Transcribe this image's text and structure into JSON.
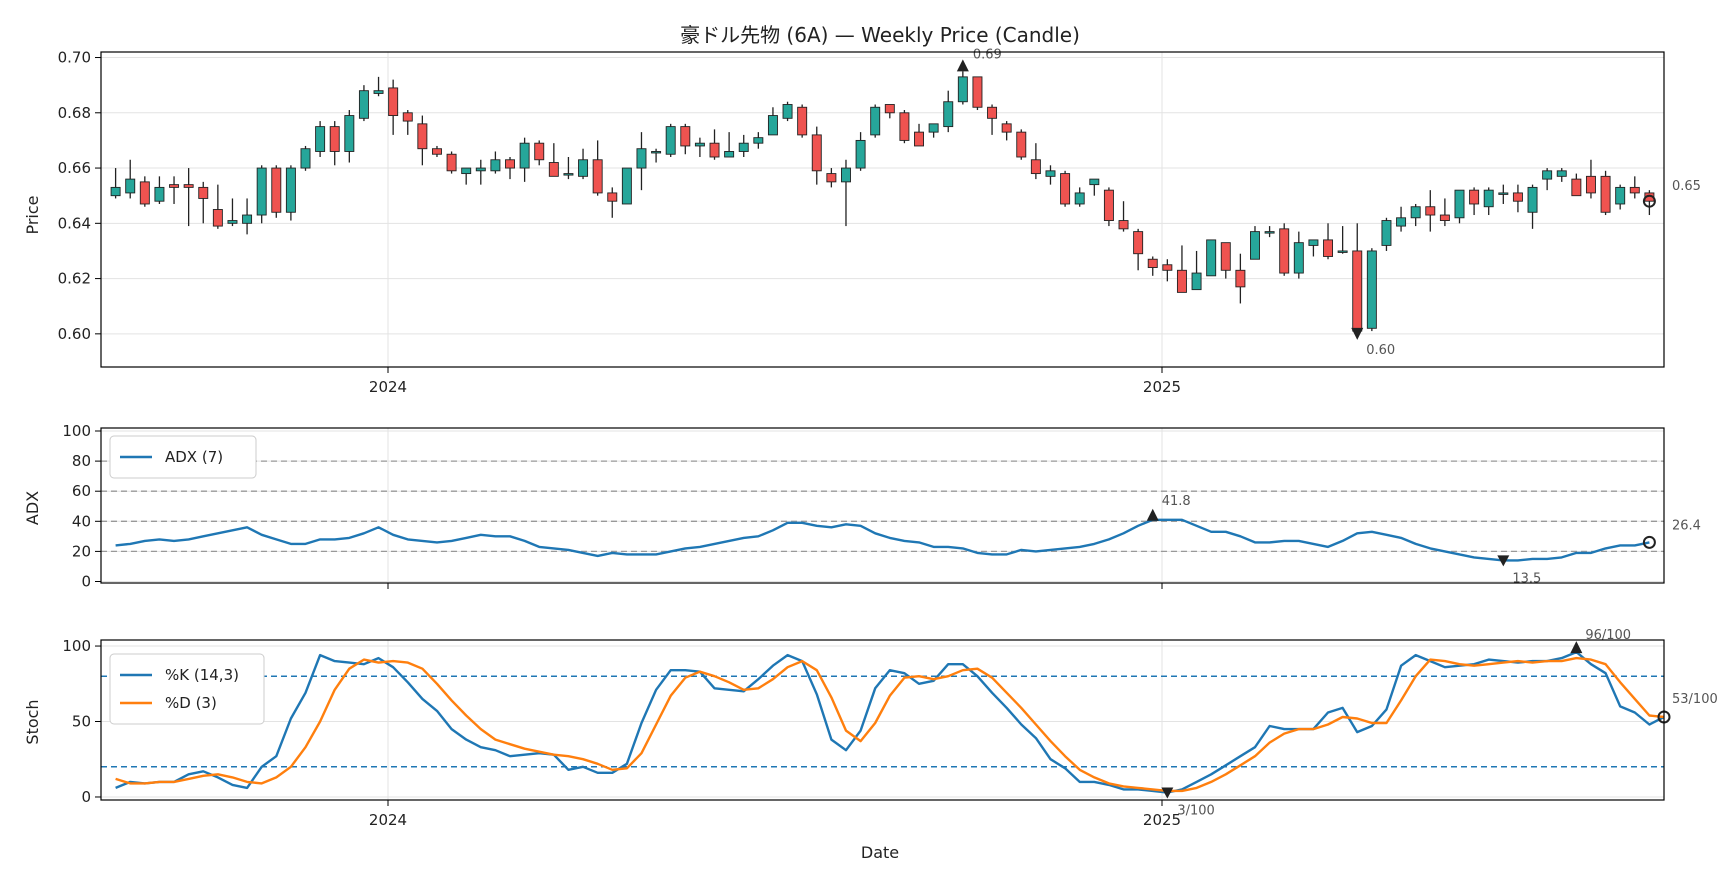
{
  "chart_data": [
    {
      "type": "candlestick",
      "title": "豪ドル先物 (6A) — Weekly Price (Candle)",
      "ylabel": "Price",
      "ylim": [
        0.588,
        0.702
      ],
      "yticks": [
        "0.60",
        "0.62",
        "0.64",
        "0.66",
        "0.68",
        "0.70"
      ],
      "xticks": [
        "2024",
        "2025"
      ],
      "up_color": "#26a69a",
      "down_color": "#ef5350",
      "annotations": {
        "high": "0.69",
        "low": "0.60",
        "last": "0.65"
      },
      "ohlc": [
        [
          0.65,
          0.66,
          0.649,
          0.653
        ],
        [
          0.651,
          0.663,
          0.649,
          0.656
        ],
        [
          0.655,
          0.657,
          0.646,
          0.647
        ],
        [
          0.648,
          0.657,
          0.647,
          0.653
        ],
        [
          0.654,
          0.657,
          0.647,
          0.653
        ],
        [
          0.654,
          0.66,
          0.639,
          0.653
        ],
        [
          0.653,
          0.655,
          0.64,
          0.649
        ],
        [
          0.645,
          0.654,
          0.638,
          0.639
        ],
        [
          0.64,
          0.649,
          0.639,
          0.641
        ],
        [
          0.64,
          0.649,
          0.636,
          0.643
        ],
        [
          0.643,
          0.661,
          0.64,
          0.66
        ],
        [
          0.66,
          0.661,
          0.642,
          0.644
        ],
        [
          0.644,
          0.661,
          0.641,
          0.66
        ],
        [
          0.66,
          0.668,
          0.659,
          0.667
        ],
        [
          0.666,
          0.677,
          0.664,
          0.675
        ],
        [
          0.675,
          0.677,
          0.661,
          0.666
        ],
        [
          0.666,
          0.681,
          0.662,
          0.679
        ],
        [
          0.678,
          0.69,
          0.677,
          0.688
        ],
        [
          0.687,
          0.693,
          0.686,
          0.688
        ],
        [
          0.689,
          0.692,
          0.672,
          0.679
        ],
        [
          0.68,
          0.681,
          0.672,
          0.677
        ],
        [
          0.676,
          0.679,
          0.661,
          0.667
        ],
        [
          0.667,
          0.668,
          0.664,
          0.665
        ],
        [
          0.665,
          0.666,
          0.658,
          0.659
        ],
        [
          0.658,
          0.659,
          0.654,
          0.66
        ],
        [
          0.659,
          0.663,
          0.654,
          0.66
        ],
        [
          0.659,
          0.666,
          0.658,
          0.663
        ],
        [
          0.663,
          0.664,
          0.656,
          0.66
        ],
        [
          0.66,
          0.671,
          0.655,
          0.669
        ],
        [
          0.669,
          0.67,
          0.661,
          0.663
        ],
        [
          0.662,
          0.669,
          0.657,
          0.657
        ],
        [
          0.658,
          0.664,
          0.656,
          0.658
        ],
        [
          0.657,
          0.667,
          0.656,
          0.663
        ],
        [
          0.663,
          0.67,
          0.65,
          0.651
        ],
        [
          0.651,
          0.653,
          0.642,
          0.648
        ],
        [
          0.647,
          0.66,
          0.647,
          0.66
        ],
        [
          0.66,
          0.673,
          0.652,
          0.667
        ],
        [
          0.666,
          0.667,
          0.662,
          0.666
        ],
        [
          0.665,
          0.676,
          0.664,
          0.675
        ],
        [
          0.675,
          0.676,
          0.665,
          0.668
        ],
        [
          0.668,
          0.671,
          0.664,
          0.669
        ],
        [
          0.669,
          0.674,
          0.663,
          0.664
        ],
        [
          0.664,
          0.673,
          0.664,
          0.666
        ],
        [
          0.666,
          0.672,
          0.664,
          0.669
        ],
        [
          0.669,
          0.673,
          0.667,
          0.671
        ],
        [
          0.672,
          0.682,
          0.672,
          0.679
        ],
        [
          0.678,
          0.684,
          0.677,
          0.683
        ],
        [
          0.682,
          0.683,
          0.671,
          0.672
        ],
        [
          0.672,
          0.675,
          0.654,
          0.659
        ],
        [
          0.658,
          0.66,
          0.653,
          0.655
        ],
        [
          0.655,
          0.663,
          0.639,
          0.66
        ],
        [
          0.66,
          0.673,
          0.659,
          0.67
        ],
        [
          0.672,
          0.683,
          0.671,
          0.682
        ],
        [
          0.683,
          0.683,
          0.678,
          0.68
        ],
        [
          0.68,
          0.681,
          0.669,
          0.67
        ],
        [
          0.673,
          0.676,
          0.668,
          0.668
        ],
        [
          0.673,
          0.675,
          0.671,
          0.676
        ],
        [
          0.675,
          0.688,
          0.673,
          0.684
        ],
        [
          0.684,
          0.695,
          0.683,
          0.693
        ],
        [
          0.693,
          0.693,
          0.681,
          0.682
        ],
        [
          0.682,
          0.683,
          0.672,
          0.678
        ],
        [
          0.676,
          0.677,
          0.67,
          0.673
        ],
        [
          0.673,
          0.674,
          0.663,
          0.664
        ],
        [
          0.663,
          0.669,
          0.656,
          0.658
        ],
        [
          0.657,
          0.661,
          0.654,
          0.659
        ],
        [
          0.658,
          0.659,
          0.646,
          0.647
        ],
        [
          0.647,
          0.653,
          0.646,
          0.651
        ],
        [
          0.654,
          0.656,
          0.65,
          0.656
        ],
        [
          0.652,
          0.653,
          0.639,
          0.641
        ],
        [
          0.641,
          0.648,
          0.637,
          0.638
        ],
        [
          0.637,
          0.638,
          0.623,
          0.629
        ],
        [
          0.627,
          0.628,
          0.621,
          0.624
        ],
        [
          0.625,
          0.627,
          0.619,
          0.623
        ],
        [
          0.623,
          0.632,
          0.615,
          0.615
        ],
        [
          0.616,
          0.63,
          0.617,
          0.622
        ],
        [
          0.621,
          0.633,
          0.621,
          0.634
        ],
        [
          0.633,
          0.633,
          0.62,
          0.623
        ],
        [
          0.623,
          0.629,
          0.611,
          0.617
        ],
        [
          0.627,
          0.639,
          0.627,
          0.637
        ],
        [
          0.637,
          0.639,
          0.635,
          0.637
        ],
        [
          0.638,
          0.64,
          0.621,
          0.622
        ],
        [
          0.622,
          0.637,
          0.62,
          0.633
        ],
        [
          0.632,
          0.634,
          0.628,
          0.634
        ],
        [
          0.634,
          0.64,
          0.627,
          0.628
        ],
        [
          0.63,
          0.639,
          0.629,
          0.63
        ],
        [
          0.63,
          0.64,
          0.6,
          0.601
        ],
        [
          0.602,
          0.631,
          0.601,
          0.63
        ],
        [
          0.632,
          0.642,
          0.63,
          0.641
        ],
        [
          0.639,
          0.646,
          0.637,
          0.642
        ],
        [
          0.642,
          0.647,
          0.639,
          0.646
        ],
        [
          0.646,
          0.652,
          0.637,
          0.643
        ],
        [
          0.643,
          0.649,
          0.639,
          0.641
        ],
        [
          0.642,
          0.652,
          0.64,
          0.652
        ],
        [
          0.652,
          0.653,
          0.643,
          0.647
        ],
        [
          0.646,
          0.653,
          0.643,
          0.652
        ],
        [
          0.651,
          0.654,
          0.647,
          0.651
        ],
        [
          0.651,
          0.654,
          0.644,
          0.648
        ],
        [
          0.644,
          0.654,
          0.638,
          0.653
        ],
        [
          0.656,
          0.66,
          0.652,
          0.659
        ],
        [
          0.657,
          0.66,
          0.655,
          0.659
        ],
        [
          0.656,
          0.658,
          0.65,
          0.65
        ],
        [
          0.657,
          0.663,
          0.649,
          0.651
        ],
        [
          0.657,
          0.659,
          0.643,
          0.644
        ],
        [
          0.647,
          0.654,
          0.645,
          0.653
        ],
        [
          0.653,
          0.657,
          0.649,
          0.651
        ],
        [
          0.651,
          0.652,
          0.643,
          0.648
        ]
      ]
    },
    {
      "type": "line",
      "ylabel": "ADX",
      "ylim": [
        -1,
        102
      ],
      "yticks": [
        "0",
        "20",
        "40",
        "60",
        "80",
        "100"
      ],
      "hlines": [
        20,
        40,
        60,
        80
      ],
      "legend": "top-left",
      "series": [
        {
          "name": "ADX (7)",
          "color": "#1f77b4",
          "values": [
            24,
            25,
            27,
            28,
            27,
            28,
            30,
            32,
            34,
            36,
            31,
            28,
            25,
            25,
            28,
            28,
            29,
            32,
            36,
            31,
            28,
            27,
            26,
            27,
            29,
            31,
            30,
            30,
            27,
            23,
            22,
            21,
            19,
            17,
            19,
            18,
            18,
            18,
            20,
            22,
            23,
            25,
            27,
            29,
            30,
            34,
            39,
            39,
            37,
            36,
            38,
            37,
            32,
            29,
            27,
            26,
            23,
            23,
            22,
            19,
            18,
            18,
            21,
            20,
            21,
            22,
            23,
            25,
            28,
            32,
            37,
            41,
            41,
            41,
            37,
            33,
            33,
            30,
            26,
            26,
            27,
            27,
            25,
            23,
            27,
            32,
            33,
            31,
            29,
            25,
            22,
            20,
            18,
            16,
            15,
            14,
            14,
            15,
            15,
            16,
            19,
            19,
            22,
            24,
            24,
            26
          ],
          "annotations": {
            "high": "41.8",
            "low": "13.5",
            "last": "26.4"
          }
        }
      ]
    },
    {
      "type": "line",
      "ylabel": "Stoch",
      "xlabel": "Date",
      "ylim": [
        -2,
        104
      ],
      "yticks": [
        "0",
        "50",
        "100"
      ],
      "xticks": [
        "2024",
        "2025"
      ],
      "hlines": [
        20,
        80
      ],
      "legend": "top-left",
      "series": [
        {
          "name": "%K (14,3)",
          "color": "#1f77b4",
          "values": [
            6,
            10,
            9,
            10,
            10,
            15,
            17,
            13,
            8,
            6,
            20,
            27,
            52,
            69,
            94,
            90,
            89,
            88,
            92,
            86,
            76,
            65,
            57,
            45,
            38,
            33,
            31,
            27,
            28,
            29,
            28,
            18,
            20,
            16,
            16,
            22,
            49,
            71,
            84,
            84,
            83,
            72,
            71,
            70,
            78,
            87,
            94,
            90,
            68,
            38,
            31,
            44,
            72,
            84,
            82,
            75,
            77,
            88,
            88,
            80,
            69,
            59,
            48,
            39,
            25,
            19,
            10,
            10,
            8,
            5,
            5,
            4,
            3,
            5,
            10,
            15,
            21,
            27,
            33,
            47,
            45,
            45,
            45,
            56,
            59,
            43,
            47,
            58,
            87,
            94,
            90,
            86,
            87,
            88,
            91,
            90,
            89,
            90,
            90,
            92,
            96,
            88,
            82,
            60,
            56,
            48,
            53
          ]
        },
        {
          "name": "%D (3)",
          "color": "#ff7f0e",
          "values": [
            12,
            9,
            9,
            10,
            10,
            12,
            14,
            15,
            13,
            10,
            9,
            13,
            20,
            33,
            50,
            71,
            85,
            91,
            89,
            90,
            89,
            85,
            75,
            64,
            54,
            45,
            38,
            35,
            32,
            30,
            28,
            27,
            25,
            22,
            18,
            19,
            29,
            48,
            67,
            79,
            83,
            80,
            76,
            71,
            72,
            78,
            86,
            90,
            84,
            66,
            44,
            37,
            49,
            67,
            79,
            80,
            78,
            80,
            84,
            85,
            79,
            69,
            59,
            48,
            37,
            27,
            18,
            13,
            9,
            7,
            6,
            5,
            4,
            4,
            6,
            10,
            15,
            21,
            27,
            36,
            42,
            45,
            45,
            48,
            53,
            52,
            49,
            49,
            64,
            80,
            91,
            90,
            88,
            87,
            88,
            89,
            90,
            89,
            90,
            90,
            92,
            91,
            88,
            76,
            65,
            54,
            53
          ],
          "annotations": {
            "high": "96/100",
            "low": "3/100",
            "last": "53/100"
          }
        }
      ]
    }
  ]
}
